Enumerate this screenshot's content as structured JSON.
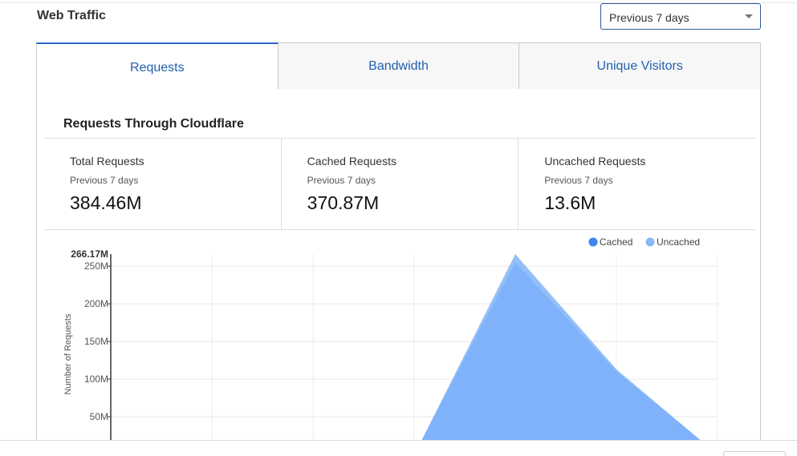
{
  "header": {
    "title": "Web Traffic",
    "range_select": {
      "value": "Previous 7 days"
    }
  },
  "tabs": [
    {
      "label": "Requests",
      "active": true
    },
    {
      "label": "Bandwidth",
      "active": false
    },
    {
      "label": "Unique Visitors",
      "active": false
    }
  ],
  "panel": {
    "title": "Requests Through Cloudflare",
    "stats": [
      {
        "label": "Total Requests",
        "period": "Previous 7 days",
        "value": "384.46M"
      },
      {
        "label": "Cached Requests",
        "period": "Previous 7 days",
        "value": "370.87M"
      },
      {
        "label": "Uncached Requests",
        "period": "Previous 7 days",
        "value": "13.6M"
      }
    ]
  },
  "colors": {
    "accent": "#2c66c7",
    "cached": "#3b86f0",
    "uncached": "#88b8f5"
  },
  "chart_data": {
    "type": "area",
    "ylabel": "Number of Requests",
    "y_max_label": "266.17M",
    "y_ticks": [
      {
        "value": 250,
        "label": "250M"
      },
      {
        "value": 200,
        "label": "200M"
      },
      {
        "value": 150,
        "label": "150M"
      },
      {
        "value": 100,
        "label": "100M"
      },
      {
        "value": 50,
        "label": "50M"
      }
    ],
    "ylim": [
      0,
      266.17
    ],
    "x_count": 7,
    "legend_position": "top-right",
    "grid": true,
    "series": [
      {
        "name": "Cached",
        "values": [
          0,
          0,
          0,
          0,
          255,
          110,
          0
        ]
      },
      {
        "name": "Uncached",
        "values": [
          0,
          0,
          0,
          0,
          11,
          3,
          0
        ]
      }
    ]
  }
}
